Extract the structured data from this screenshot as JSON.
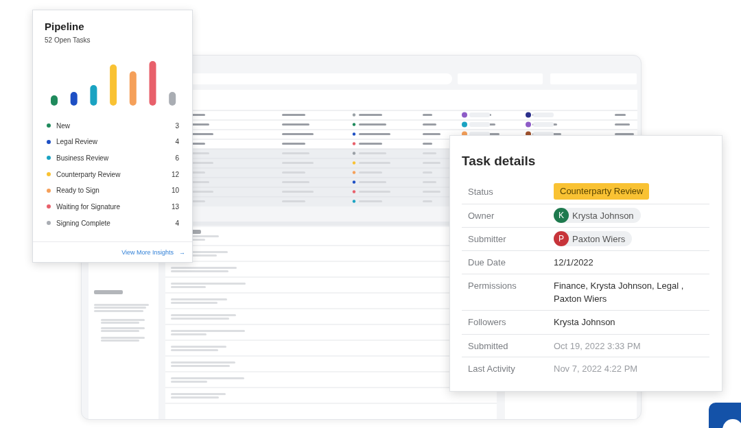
{
  "pipeline": {
    "title": "Pipeline",
    "subtitle": "52 Open Tasks",
    "legend": [
      {
        "label": "New",
        "count": "3",
        "color": "#1f8a5c"
      },
      {
        "label": "Legal Review",
        "count": "4",
        "color": "#1d4fc4"
      },
      {
        "label": "Business Review",
        "count": "6",
        "color": "#1aa3c2"
      },
      {
        "label": "Counterparty Review",
        "count": "12",
        "color": "#f9c233"
      },
      {
        "label": "Ready to Sign",
        "count": "10",
        "color": "#f5a05a"
      },
      {
        "label": "Waiting for Signature",
        "count": "13",
        "color": "#e8606b"
      },
      {
        "label": "Signing Complete",
        "count": "4",
        "color": "#a9adb3"
      }
    ],
    "link": "View More Insights",
    "link_icon": "→"
  },
  "task_details": {
    "title": "Task details",
    "fields": [
      {
        "label": "Status",
        "kind": "badge",
        "value": "Counterparty Review"
      },
      {
        "label": "Owner",
        "kind": "person",
        "initial": "K",
        "value": "Krysta Johnson",
        "color": "#1e7a4e"
      },
      {
        "label": "Submitter",
        "kind": "person",
        "initial": "P",
        "value": "Paxton Wiers",
        "color": "#c7343a"
      },
      {
        "label": "Due Date",
        "kind": "text",
        "value": "12/1/2022"
      },
      {
        "label": "Permissions",
        "kind": "text",
        "value": "Finance, Krysta Johnson, Legal , Paxton Wiers"
      },
      {
        "label": "Followers",
        "kind": "text",
        "value": "Krysta Johnson"
      },
      {
        "label": "Submitted",
        "kind": "muted",
        "value": "Oct 19, 2022 3:33 PM"
      },
      {
        "label": "Last Activity",
        "kind": "muted",
        "value": "Nov 7, 2022 4:22 PM"
      }
    ]
  }
}
